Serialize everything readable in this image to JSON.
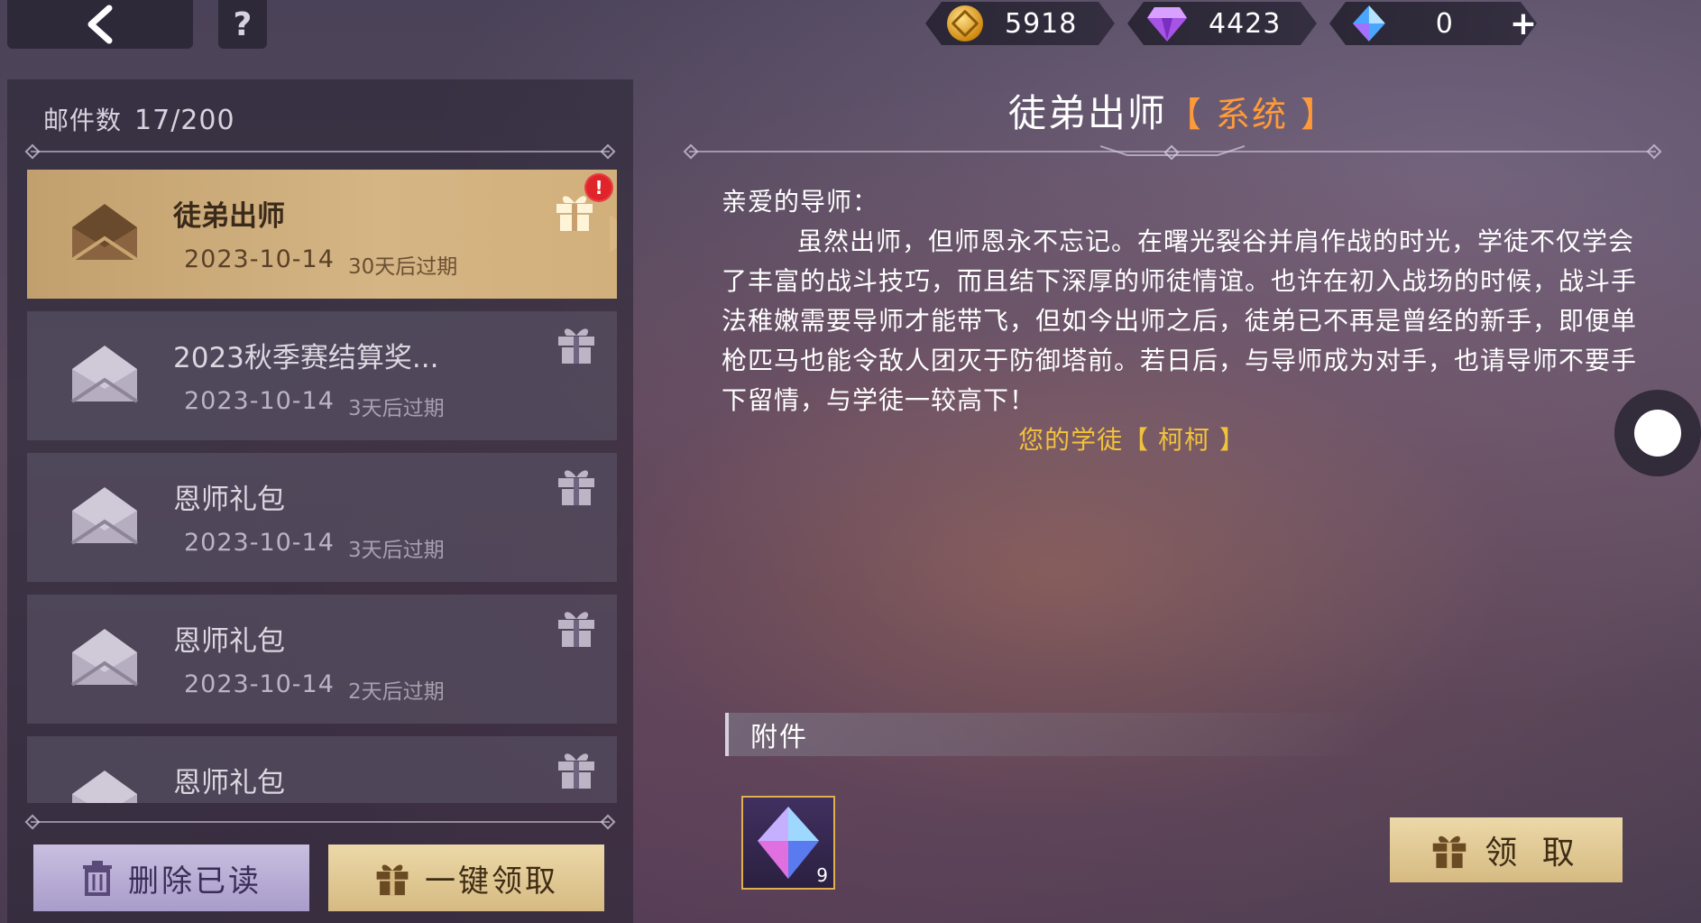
{
  "topbar": {
    "help_label": "?",
    "coins": "5918",
    "diamonds": "4423",
    "crystals": "0",
    "plus_label": "+"
  },
  "mailbox": {
    "count_label": "邮件数",
    "count_value": "17/200",
    "items": [
      {
        "title": "徒弟出师",
        "date": "2023-10-14",
        "expire": "30天后过期",
        "selected": true,
        "unread_badge": "!"
      },
      {
        "title": "2023秋季赛结算奖...",
        "date": "2023-10-14",
        "expire": "3天后过期"
      },
      {
        "title": "恩师礼包",
        "date": "2023-10-14",
        "expire": "3天后过期"
      },
      {
        "title": "恩师礼包",
        "date": "2023-10-14",
        "expire": "2天后过期"
      },
      {
        "title": "恩师礼包",
        "date": "",
        "expire": ""
      }
    ],
    "delete_read_label": "删除已读",
    "claim_all_label": "一键领取"
  },
  "mail": {
    "title": "徒弟出师",
    "tag": "【 系统 】",
    "greeting": "亲爱的导师：",
    "body": "虽然出师，但师恩永不忘记。在曙光裂谷并肩作战的时光，学徒不仅学会了丰富的战斗技巧，而且结下深厚的师徒情谊。也许在初入战场的时候，战斗手法稚嫩需要导师才能带飞，但如今出师之后，徒弟已不再是曾经的新手，即便单枪匹马也能令敌人团灭于防御塔前。若日后，与导师成为对手，也请导师不要手下留情，与学徒一较高下！",
    "signature": "您的学徒【 柯柯 】",
    "attachment_label": "附件",
    "attachment_count": "9",
    "claim_label": "领 取"
  },
  "colors": {
    "accent_gold": "#d6ba82",
    "tag_orange": "#ff9a3a",
    "signature_yellow": "#f1c23c",
    "badge_red": "#e0242a"
  }
}
